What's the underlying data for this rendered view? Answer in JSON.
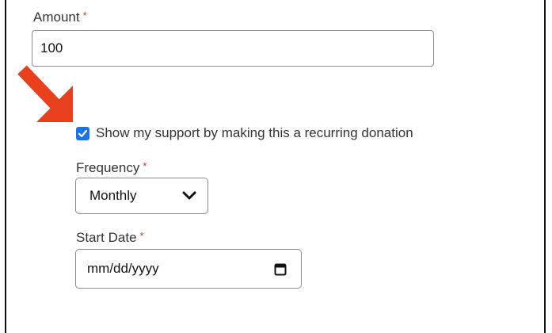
{
  "amount": {
    "label": "Amount",
    "required_mark": "*",
    "value": "100"
  },
  "annotation": {
    "icon": "red-arrow-icon",
    "color": "#e8401c"
  },
  "recurring": {
    "checked": true,
    "label": "Show my support by making this a recurring donation"
  },
  "frequency": {
    "label": "Frequency",
    "required_mark": "*",
    "selected": "Monthly"
  },
  "start_date": {
    "label": "Start Date",
    "required_mark": "*",
    "placeholder": "mm/dd/yyyy"
  },
  "colors": {
    "required": "#c0392b",
    "checkbox": "#1a73e8"
  }
}
